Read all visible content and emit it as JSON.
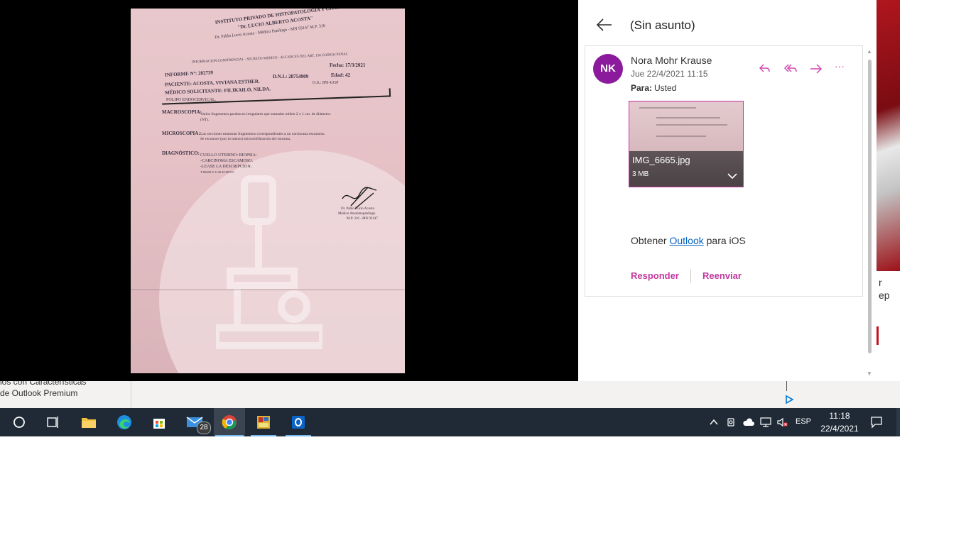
{
  "background": {
    "left_text_line1": "ios con Características",
    "left_text_line2": "de Outlook Premium",
    "right_text_1": "r",
    "right_text_2": "ep"
  },
  "viewer": {
    "photo_name": "document-photo",
    "doc_header_1": "INSTITUTO PRIVADO DE HISTOPATOLOGÍA Y CITODIAGNÓSTICO",
    "doc_header_2": "\"Dr. LUCIO ALBERTO ACOSTA\"",
    "doc_header_3": "Dr. Pablo Lucio Acosta - Médico Patólogo - MN 93147 M.P. 316",
    "doc_confidential": "INFORMACION CONFIDENCIAL - SECRETO MEDICO - ALCANCES DEL ART. 156 CODIGO PENAL",
    "doc_fecha": "Fecha: 17/3/2021",
    "doc_informe": "INFORME Nº: 282739",
    "doc_dni": "D.N.I.: 28754909",
    "doc_edad": "Edad: 42",
    "doc_paciente": "PACIENTE: ACOSTA, VIVIANA ESTHER.",
    "doc_os": "O.S.: IPS-UGP",
    "doc_medico": "MÉDICO SOLICITANTE: FILIKAILO, NILDA.",
    "doc_polipo": "POLIPO ENDOCERVICAL.",
    "doc_macro_label": "MACROSCOPIA:",
    "doc_macro_text": "Varios fragmentos pardoscos irregulares que sumados miden 2 x 1 cm. de diámetro.",
    "doc_macro_nt": "(NT).",
    "doc_micro_label": "MICROSCOPIA:",
    "doc_micro_text": "Las secciones muestran fragmentos correspondientes a un carcinoma escamoso.",
    "doc_micro_text2": "Se reconoce (por lo menos) microinfiltración del estroma.",
    "doc_diag_label": "DIAGNÓSTICO:",
    "doc_diag_1": "CUELLO UTERINO: BIOPSIA:",
    "doc_diag_2": "-CARCINOMA ESCAMOSO.",
    "doc_diag_3": "-LEASE LA DESCRIPCION.",
    "doc_codes": "T-80600 P-1140 M-80703",
    "doc_sign_1": "Dr. Pablo Lucio Acosta",
    "doc_sign_2": "Médico Anatomopatólogo",
    "doc_sign_3": "M.P. 316 - MN 93147"
  },
  "email": {
    "subject": "(Sin asunto)",
    "avatar_initials": "NK",
    "avatar_color": "#8b1a9c",
    "sender": "Nora Mohr Krause",
    "date": "Jue 22/4/2021 11:15",
    "to_label": "Para:",
    "to_value": "Usted",
    "attachment_name": "IMG_6665.jpg",
    "attachment_size": "3 MB",
    "body_prefix": "Obtener ",
    "body_link": "Outlook",
    "body_suffix": " para iOS",
    "reply_label": "Responder",
    "forward_label": "Reenviar",
    "accent_color": "#c2389f"
  },
  "actions": {
    "reply_icon": "reply-icon",
    "reply_all_icon": "reply-all-icon",
    "forward_icon": "forward-icon",
    "more_icon": "more-icon",
    "more_glyph": "···"
  },
  "taskbar": {
    "mail_badge": "28",
    "lang": "ESP",
    "time": "11:18",
    "date": "22/4/2021"
  }
}
